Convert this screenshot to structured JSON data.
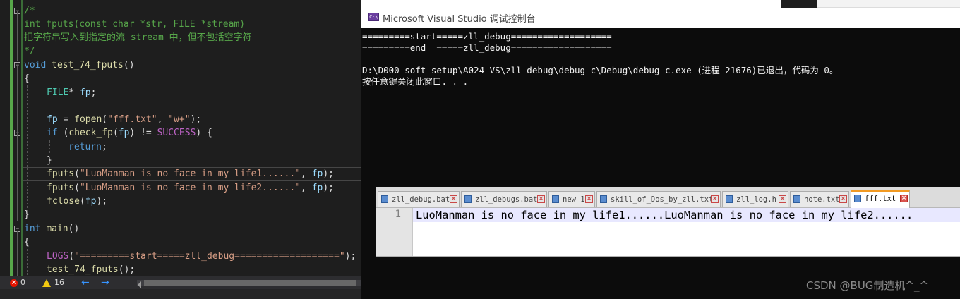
{
  "vs_editor": {
    "lines": [
      {
        "segments": [
          {
            "t": "/*",
            "c": "c-comment"
          }
        ]
      },
      {
        "segments": [
          {
            "t": "int fputs(const char *str, FILE *stream)",
            "c": "c-comment"
          }
        ]
      },
      {
        "segments": [
          {
            "t": "把字符串写入到指定的流 stream 中，但不包括空字符",
            "c": "c-comment"
          }
        ]
      },
      {
        "segments": [
          {
            "t": "*/",
            "c": "c-comment"
          }
        ]
      },
      {
        "segments": [
          {
            "t": "void",
            "c": "c-kw"
          },
          {
            "t": " ",
            "c": "c-plain"
          },
          {
            "t": "test_74_fputs",
            "c": "c-fn"
          },
          {
            "t": "()",
            "c": "c-plain"
          }
        ]
      },
      {
        "segments": [
          {
            "t": "{",
            "c": "c-plain"
          }
        ]
      },
      {
        "segments": [
          {
            "t": "FILE",
            "c": "c-type"
          },
          {
            "t": "* ",
            "c": "c-plain"
          },
          {
            "t": "fp",
            "c": "c-var"
          },
          {
            "t": ";",
            "c": "c-plain"
          }
        ]
      },
      {
        "segments": []
      },
      {
        "segments": [
          {
            "t": "fp",
            "c": "c-var"
          },
          {
            "t": " = ",
            "c": "c-plain"
          },
          {
            "t": "fopen",
            "c": "c-fn"
          },
          {
            "t": "(",
            "c": "c-plain"
          },
          {
            "t": "\"fff.txt\"",
            "c": "c-str"
          },
          {
            "t": ", ",
            "c": "c-plain"
          },
          {
            "t": "\"w+\"",
            "c": "c-str"
          },
          {
            "t": ");",
            "c": "c-plain"
          }
        ]
      },
      {
        "segments": [
          {
            "t": "if",
            "c": "c-kw"
          },
          {
            "t": " (",
            "c": "c-plain"
          },
          {
            "t": "check_fp",
            "c": "c-fn"
          },
          {
            "t": "(",
            "c": "c-plain"
          },
          {
            "t": "fp",
            "c": "c-var"
          },
          {
            "t": ") != ",
            "c": "c-plain"
          },
          {
            "t": "SUCCESS",
            "c": "c-macro"
          },
          {
            "t": ") {",
            "c": "c-plain"
          }
        ]
      },
      {
        "segments": [
          {
            "t": "return",
            "c": "c-kw"
          },
          {
            "t": ";",
            "c": "c-plain"
          }
        ]
      },
      {
        "segments": [
          {
            "t": "}",
            "c": "c-plain"
          }
        ]
      },
      {
        "segments": [
          {
            "t": "fputs",
            "c": "c-fn"
          },
          {
            "t": "(",
            "c": "c-plain"
          },
          {
            "t": "\"LuoManman is no face in my life1......\"",
            "c": "c-str"
          },
          {
            "t": ", ",
            "c": "c-plain"
          },
          {
            "t": "fp",
            "c": "c-var"
          },
          {
            "t": ");",
            "c": "c-plain"
          }
        ]
      },
      {
        "segments": [
          {
            "t": "fputs",
            "c": "c-fn"
          },
          {
            "t": "(",
            "c": "c-plain"
          },
          {
            "t": "\"LuoManman is no face in my life2......\"",
            "c": "c-str"
          },
          {
            "t": ", ",
            "c": "c-plain"
          },
          {
            "t": "fp",
            "c": "c-var"
          },
          {
            "t": ");",
            "c": "c-plain"
          }
        ]
      },
      {
        "segments": [
          {
            "t": "fclose",
            "c": "c-fn"
          },
          {
            "t": "(",
            "c": "c-plain"
          },
          {
            "t": "fp",
            "c": "c-var"
          },
          {
            "t": ");",
            "c": "c-plain"
          }
        ]
      },
      {
        "segments": [
          {
            "t": "}",
            "c": "c-plain"
          }
        ]
      },
      {
        "segments": [
          {
            "t": "int",
            "c": "c-kw"
          },
          {
            "t": " ",
            "c": "c-plain"
          },
          {
            "t": "main",
            "c": "c-fn"
          },
          {
            "t": "()",
            "c": "c-plain"
          }
        ]
      },
      {
        "segments": [
          {
            "t": "{",
            "c": "c-plain"
          }
        ]
      },
      {
        "segments": [
          {
            "t": "LOGS",
            "c": "c-macro"
          },
          {
            "t": "(",
            "c": "c-plain"
          },
          {
            "t": "\"=========start=====zll_debug===================\"",
            "c": "c-str"
          },
          {
            "t": ");",
            "c": "c-plain"
          }
        ]
      },
      {
        "segments": [
          {
            "t": "test_74_fputs",
            "c": "c-fn"
          },
          {
            "t": "();",
            "c": "c-plain"
          }
        ]
      }
    ],
    "status": {
      "errors": "0",
      "warnings": "16",
      "back_arrow": "←",
      "forward_arrow": "→"
    }
  },
  "console": {
    "title": "Microsoft Visual Studio 调试控制台",
    "icon": "console-app-icon",
    "lines": [
      "=========start=====zll_debug===================",
      "=========end  =====zll_debug===================",
      "",
      "D:\\D000_soft_setup\\A024_VS\\zll_debug\\debug_c\\Debug\\debug_c.exe (进程 21676)已退出，代码为 0。",
      "按任意键关闭此窗口. . ."
    ]
  },
  "notepadpp": {
    "tabs": [
      {
        "label": "zll_debug.bat"
      },
      {
        "label": "zll_debugs.bat"
      },
      {
        "label": "new 1"
      },
      {
        "label": "skill_of_Dos_by_zll.txt"
      },
      {
        "label": "zll_log.h"
      },
      {
        "label": "note.txt"
      },
      {
        "label": "fff.txt",
        "active": true
      }
    ],
    "line_number": "1",
    "content": "LuoManman is no face in my life1......LuoManman is no face in my life2......"
  },
  "watermark": "CSDN @BUG制造机^_^",
  "colors": {
    "vs_background": "#1e1e1e",
    "comment": "#57a64a",
    "keyword": "#569cd6",
    "function": "#dcdcaa",
    "string": "#d69d85",
    "variable": "#9cdcfe",
    "macro": "#bd63c5",
    "console_background": "#0c0c0c",
    "active_tab_accent": "#f29a22"
  }
}
